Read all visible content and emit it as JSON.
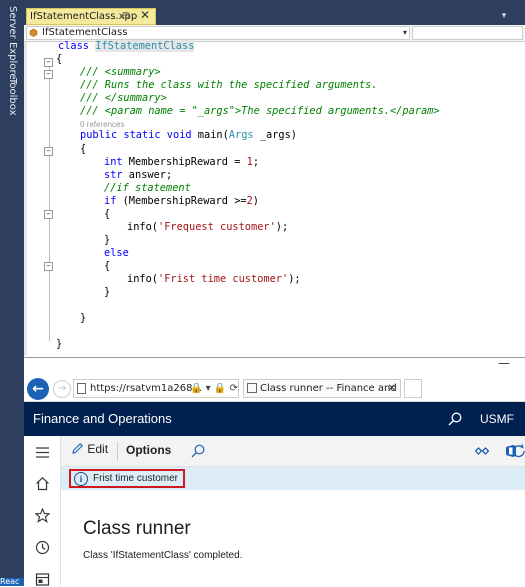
{
  "vs": {
    "side_labels": [
      "Server Explorer",
      "Toolbox"
    ],
    "tab": {
      "title": "IfStatementClass.xpp",
      "pin": "⊞",
      "close": "✕"
    },
    "tab_overflow": "▾",
    "nav": {
      "class_name": "IfStatementClass",
      "arrow": "▾"
    },
    "code": {
      "l1_kw": "class",
      "l1_name": "IfStatementClass",
      "l2": "{",
      "l3": "/// <summary>",
      "l4": "/// Runs the class with the specified arguments.",
      "l5": "/// </summary>",
      "l6": "/// <param name = \"_args\">The specified arguments.</param>",
      "refs": "0 references",
      "l8_kw": "public static void",
      "l8_rest": " main(",
      "l8_type": "Args",
      "l8_end": " _args)",
      "l9": "{",
      "l10_kw": "int",
      "l10_rest": " MembershipReward = ",
      "l10_num": "1",
      "l10_end": ";",
      "l11_kw": "str",
      "l11_rest": " answer;",
      "l12": "//if statement",
      "l13_kw": "if",
      "l13_rest": " (MembershipReward >=",
      "l13_num": "2",
      "l13_end": ")",
      "l14": "{",
      "l15_pre": "info(",
      "l15_str": "'Frequest customer'",
      "l15_end": ");",
      "l16": "}",
      "l17": "else",
      "l18": "{",
      "l19_pre": "info(",
      "l19_str": "'Frist time customer'",
      "l19_end": ");",
      "l20": "}",
      "l21": "}",
      "l22": "}"
    }
  },
  "browser": {
    "minimize": "—",
    "back": "←",
    "forward": "→",
    "url": "https://rsatvm1a268...",
    "url_tools": "🔒 ▾ 🔒 ⟳",
    "tab_title": "Class runner -- Finance and O...",
    "tab_close": "✕"
  },
  "fo": {
    "app_title": "Finance and Operations",
    "company": "USMF",
    "action_pane": {
      "edit": "Edit",
      "options": "Options"
    },
    "message": "Frist time customer",
    "page_title": "Class runner",
    "status": "Class 'IfStatementClass' completed."
  },
  "taskbar_text": "Reac",
  "colors": {
    "vs_frame": "#2d3e5f",
    "fo_header": "#002050",
    "message_bar": "#dcedf8",
    "highlight_border": "#d0181f"
  }
}
